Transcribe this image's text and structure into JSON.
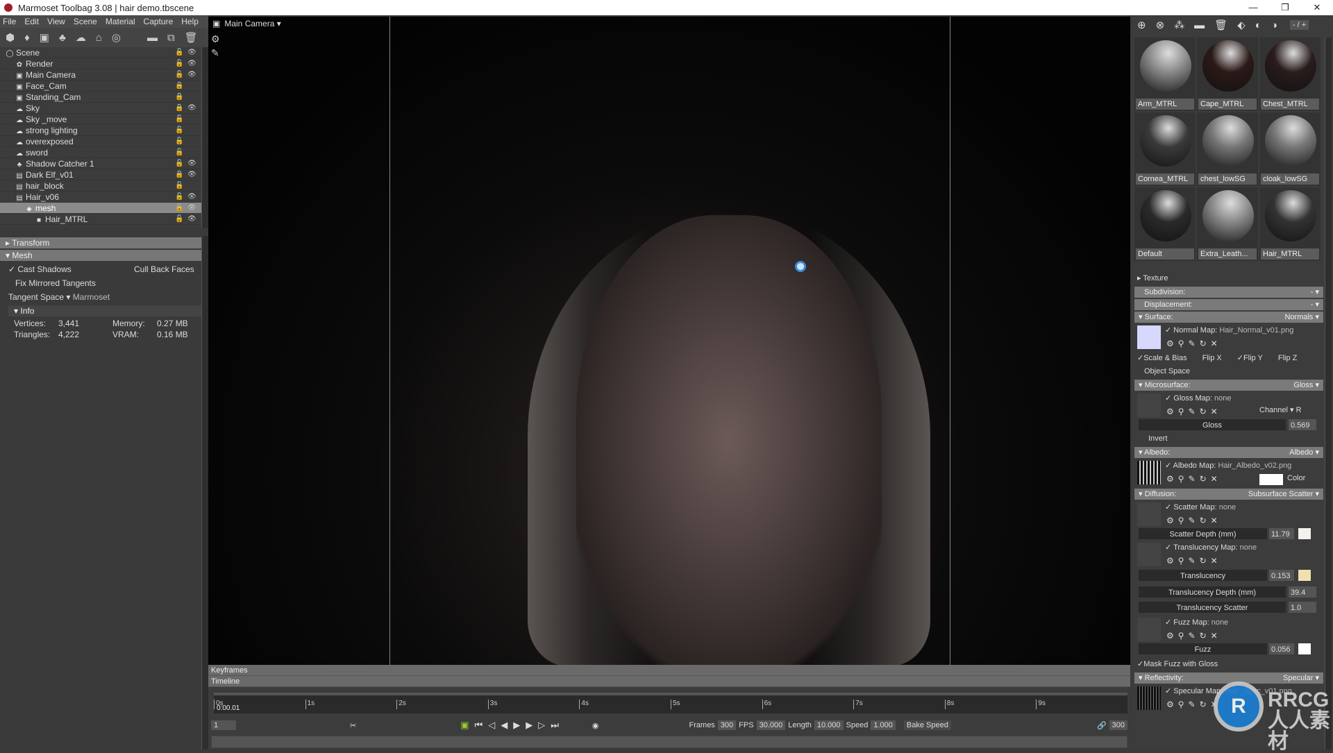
{
  "window": {
    "title": "Marmoset Toolbag 3.08  |  hair demo.tbscene",
    "controls": [
      "—",
      "❐",
      "✕"
    ]
  },
  "menu": [
    "File",
    "Edit",
    "View",
    "Scene",
    "Material",
    "Capture",
    "Help"
  ],
  "left_toolbar_icons": [
    "cube-icon",
    "bulb-icon",
    "camera-icon",
    "shadow-catcher-icon",
    "sky-icon",
    "hat-icon",
    "disc-icon",
    "folder-icon",
    "duplicate-icon",
    "trash-icon"
  ],
  "tree": [
    {
      "label": "Scene",
      "indent": 0,
      "icon": "◯",
      "lock": false,
      "eye": true
    },
    {
      "label": "Render",
      "indent": 1,
      "icon": "✿",
      "lock": false,
      "eye": true
    },
    {
      "label": "Main Camera",
      "indent": 1,
      "icon": "▣",
      "lock": false,
      "eye": true
    },
    {
      "label": "Face_Cam",
      "indent": 1,
      "icon": "▣",
      "lock": true,
      "eye": false
    },
    {
      "label": "Standing_Cam",
      "indent": 1,
      "icon": "▣",
      "lock": true,
      "eye": false
    },
    {
      "label": "Sky",
      "indent": 1,
      "icon": "☁",
      "lock": true,
      "eye": true
    },
    {
      "label": "Sky _move",
      "indent": 1,
      "icon": "☁",
      "lock": false,
      "eye": false
    },
    {
      "label": "strong lighting",
      "indent": 1,
      "icon": "☁",
      "lock": false,
      "eye": false
    },
    {
      "label": "overexposed",
      "indent": 1,
      "icon": "☁",
      "lock": false,
      "eye": false
    },
    {
      "label": "sword",
      "indent": 1,
      "icon": "☁",
      "lock": false,
      "eye": false
    },
    {
      "label": "Shadow Catcher 1",
      "indent": 1,
      "icon": "♣",
      "lock": false,
      "eye": true
    },
    {
      "label": "Dark Elf_v01",
      "indent": 1,
      "icon": "▤",
      "lock": true,
      "eye": true
    },
    {
      "label": "hair_block",
      "indent": 1,
      "icon": "▤",
      "lock": false,
      "eye": false
    },
    {
      "label": "Hair_v06",
      "indent": 1,
      "icon": "▤",
      "lock": false,
      "eye": true
    },
    {
      "label": "mesh",
      "indent": 2,
      "icon": "◈",
      "lock": false,
      "eye": true,
      "selected": true
    },
    {
      "label": "Hair_MTRL",
      "indent": 3,
      "icon": "■",
      "lock": false,
      "eye": true
    }
  ],
  "props": {
    "transform": "Transform",
    "mesh": "Mesh",
    "cast_shadows": "Cast Shadows",
    "cull_back_faces": "Cull Back Faces",
    "fix_mirrored": "Fix Mirrored Tangents",
    "tangent_space_label": "Tangent Space",
    "tangent_space_value": "Marmoset",
    "info": "Info",
    "vertices_label": "Vertices:",
    "vertices": "3,441",
    "triangles_label": "Triangles:",
    "triangles": "4,222",
    "memory_label": "Memory:",
    "memory": "0.27 MB",
    "vram_label": "VRAM:",
    "vram": "0.16 MB"
  },
  "viewport": {
    "camera": "Main Camera"
  },
  "timeline": {
    "keyframes": "Keyframes",
    "timeline": "Timeline",
    "ticks": [
      "0s",
      "1s",
      "2s",
      "3s",
      "4s",
      "5s",
      "6s",
      "7s",
      "8s",
      "9s"
    ],
    "current_time": "0:00.01",
    "frame": "1",
    "frames_label": "Frames",
    "frames": "300",
    "fps_label": "FPS",
    "fps": "30.000",
    "length_label": "Length",
    "length": "10.000",
    "speed_label": "Speed",
    "speed": "1.000",
    "bake_speed": "Bake Speed",
    "end_frame": "300"
  },
  "materials": {
    "page": "- / +",
    "items": [
      {
        "name": "Arm_MTRL",
        "color": "#8a8a8a"
      },
      {
        "name": "Cape_MTRL",
        "color": "#2a1a18"
      },
      {
        "name": "Chest_MTRL",
        "color": "#2a1c1c"
      },
      {
        "name": "Cornea_MTRL",
        "color": "#3a3a3a"
      },
      {
        "name": "chest_lowSG",
        "color": "#777"
      },
      {
        "name": "cloak_lowSG",
        "color": "#777"
      },
      {
        "name": "Default",
        "color": "#2a2a2a"
      },
      {
        "name": "Extra_Leath...",
        "color": "#888"
      },
      {
        "name": "Hair_MTRL",
        "color": "#333"
      }
    ]
  },
  "material_props": {
    "texture": "Texture",
    "subdivision": "Subdivision:",
    "displacement": "Displacement:",
    "surface": "Surface:",
    "surface_mode": "Normals",
    "normal_map": "Normal Map:",
    "normal_file": "Hair_Normal_v01.png",
    "scale_bias": "Scale & Bias",
    "flip_x": "Flip X",
    "flip_y": "Flip Y",
    "flip_z": "Flip Z",
    "object_space": "Object Space",
    "microsurface": "Microsurface:",
    "micro_mode": "Gloss",
    "gloss_map": "Gloss Map:",
    "gloss_file": "none",
    "channel": "Channel",
    "channel_value": "R",
    "gloss_label": "Gloss",
    "gloss": "0.569",
    "invert": "Invert",
    "albedo": "Albedo:",
    "albedo_mode": "Albedo",
    "albedo_map": "Albedo Map:",
    "albedo_file": "Hair_Albedo_v02.png",
    "color": "Color",
    "diffusion": "Diffusion:",
    "diffusion_mode": "Subsurface Scatter",
    "scatter_map": "Scatter Map:",
    "scatter_file": "none",
    "scatter_depth_label": "Scatter Depth (mm)",
    "scatter_depth": "11.79",
    "translucency_map": "Translucency Map:",
    "translucency_file": "none",
    "translucency_label": "Translucency",
    "translucency": "0.153",
    "trans_depth_label": "Translucency Depth (mm)",
    "trans_depth": "39.4",
    "trans_scatter_label": "Translucency Scatter",
    "trans_scatter": "1.0",
    "fuzz_map": "Fuzz Map:",
    "fuzz_file": "none",
    "fuzz_label": "Fuzz",
    "fuzz": "0.056",
    "mask_fuzz": "Mask Fuzz with Gloss",
    "reflectivity": "Reflectivity:",
    "reflect_mode": "Specular",
    "specular_map": "Specular Map:",
    "specular_file": "Hair_Spec_v01.png"
  },
  "colors": {
    "scatter": "#f4f0ec",
    "translucency": "#f0e0b0",
    "fuzz": "#ffffff",
    "albedo_color": "#ffffff",
    "normal_swatch": "#d8d8ff",
    "selection": "#8a8a8a",
    "lock_red": "#dd2222"
  },
  "watermark": "RRCG 人人素材"
}
